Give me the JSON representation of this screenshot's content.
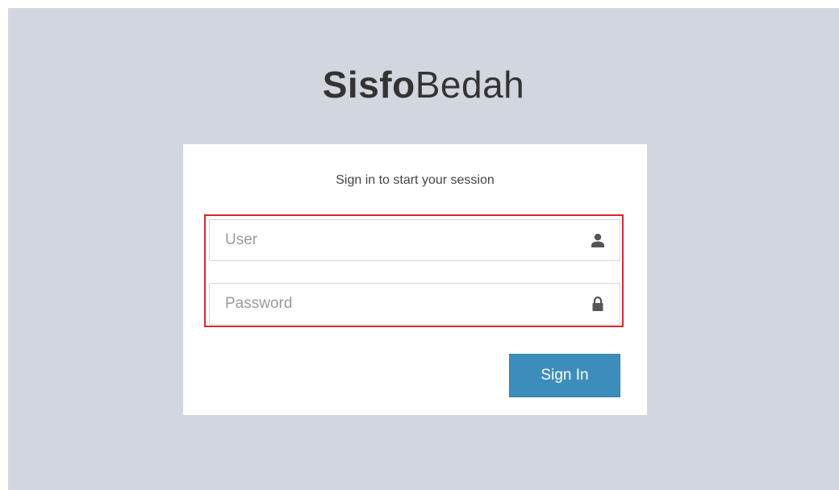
{
  "logo": {
    "bold": "Sisfo",
    "light": "Bedah"
  },
  "login_box": {
    "message": "Sign in to start your session",
    "user_field": {
      "placeholder": "User",
      "value": "",
      "icon": "user-icon"
    },
    "password_field": {
      "placeholder": "Password",
      "value": "",
      "icon": "lock-icon"
    },
    "sign_in_label": "Sign In"
  },
  "colors": {
    "background": "#d2d6de",
    "box": "#ffffff",
    "button": "#3c8dbc",
    "highlight_border": "#d9262c"
  }
}
